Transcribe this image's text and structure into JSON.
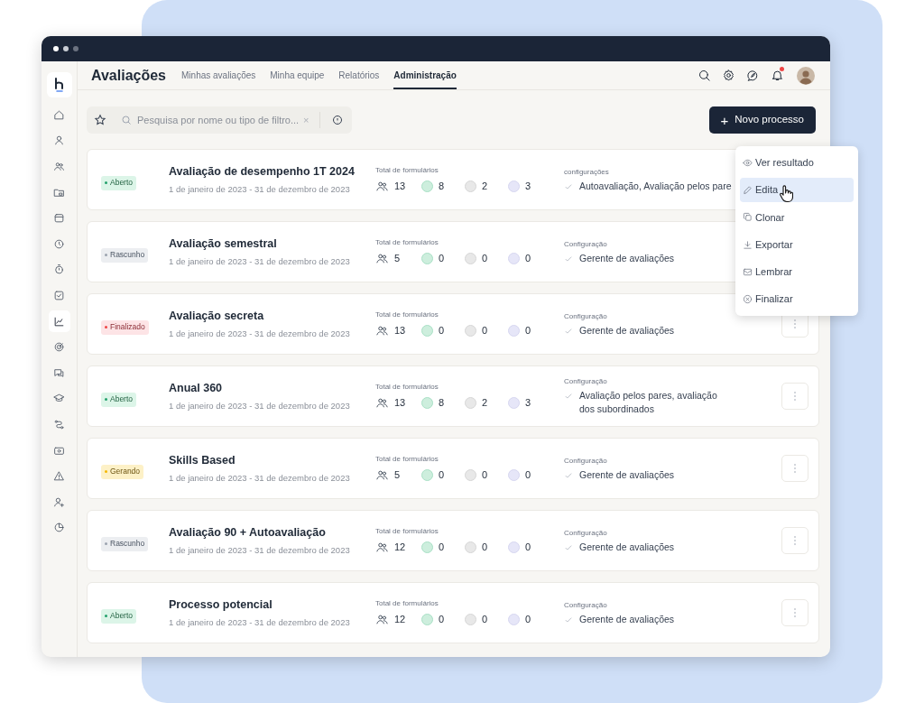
{
  "header": {
    "title": "Avaliações",
    "tabs": [
      {
        "label": "Minhas avaliações",
        "selected": false
      },
      {
        "label": "Minha equipe",
        "selected": false
      },
      {
        "label": "Relatórios",
        "selected": false
      },
      {
        "label": "Administração",
        "selected": true
      }
    ],
    "notifications_unread": true
  },
  "sidebar": {
    "items": [
      {
        "selected": false
      },
      {
        "selected": false
      },
      {
        "selected": false
      },
      {
        "selected": false
      },
      {
        "selected": false
      },
      {
        "selected": false
      },
      {
        "selected": false
      },
      {
        "selected": false
      },
      {
        "selected": true
      },
      {
        "selected": false
      },
      {
        "selected": false
      },
      {
        "selected": false
      },
      {
        "selected": false
      },
      {
        "selected": false
      },
      {
        "selected": false
      },
      {
        "selected": false
      },
      {
        "selected": false
      }
    ]
  },
  "search": {
    "placeholder": "Pesquisa por nome ou tipo de filtro...",
    "clear": "×"
  },
  "new_button": {
    "icon": "+",
    "label": "Novo processo"
  },
  "processes": [
    {
      "status": {
        "label": "Aberto",
        "kind": "open"
      },
      "title": "Avaliação de desempenho 1T 2024",
      "dates": "1 de janeiro de 2023 - 31 de dezembro de 2023",
      "forms_label": "Total de formulários",
      "total": "13",
      "counts": [
        "8",
        "2",
        "3"
      ],
      "config_label": "configurações",
      "config": "Autoavaliação, Avaliação pelos pare",
      "more_button": false
    },
    {
      "status": {
        "label": "Rascunho",
        "kind": "draft"
      },
      "title": "Avaliação semestral",
      "dates": "1 de janeiro de 2023 - 31 de dezembro de 2023",
      "forms_label": "Total de formulários",
      "total": "5",
      "counts": [
        "0",
        "0",
        "0"
      ],
      "config_label": "Configuração",
      "config": "Gerente de avaliações",
      "more_button": false
    },
    {
      "status": {
        "label": "Finalizado",
        "kind": "closed"
      },
      "title": "Avaliação secreta",
      "dates": "1 de janeiro de 2023 - 31 de dezembro de 2023",
      "forms_label": "Total de formulários",
      "total": "13",
      "counts": [
        "0",
        "0",
        "0"
      ],
      "config_label": "Configuração",
      "config": "Gerente de avaliações",
      "more_button": true
    },
    {
      "status": {
        "label": "Aberto",
        "kind": "open"
      },
      "title": "Anual 360",
      "dates": "1 de janeiro de 2023 - 31 de dezembro de 2023",
      "forms_label": "Total de formulários",
      "total": "13",
      "counts": [
        "8",
        "2",
        "3"
      ],
      "config_label": "Configuração",
      "config": "Avaliação pelos pares, avaliação\ndos subordinados",
      "more_button": true
    },
    {
      "status": {
        "label": "Gerando",
        "kind": "generating"
      },
      "title": "Skills Based",
      "dates": "1 de janeiro de 2023 - 31 de dezembro de 2023",
      "forms_label": "Total de formulários",
      "total": "5",
      "counts": [
        "0",
        "0",
        "0"
      ],
      "config_label": "Configuração",
      "config": "Gerente de avaliações",
      "more_button": true
    },
    {
      "status": {
        "label": "Rascunho",
        "kind": "draft"
      },
      "title": "Avaliação 90 + Autoavaliação",
      "dates": "1 de janeiro de 2023 - 31 de dezembro de 2023",
      "forms_label": "Total de formulários",
      "total": "12",
      "counts": [
        "0",
        "0",
        "0"
      ],
      "config_label": "Configuração",
      "config": "Gerente de avaliações",
      "more_button": true
    },
    {
      "status": {
        "label": "Aberto",
        "kind": "open"
      },
      "title": "Processo potencial",
      "dates": "1 de janeiro de 2023 - 31 de dezembro de 2023",
      "forms_label": "Total de formulários",
      "total": "12",
      "counts": [
        "0",
        "0",
        "0"
      ],
      "config_label": "Configuração",
      "config": "Gerente de avaliações",
      "more_button": true
    }
  ],
  "context_menu": {
    "items": [
      {
        "label": "Ver resultado",
        "selected": false
      },
      {
        "label": "Edita",
        "selected": true
      },
      {
        "label": "Clonar",
        "selected": false
      },
      {
        "label": "Exportar",
        "selected": false
      },
      {
        "label": "Lembrar",
        "selected": false
      },
      {
        "label": "Finalizar",
        "selected": false
      }
    ]
  }
}
